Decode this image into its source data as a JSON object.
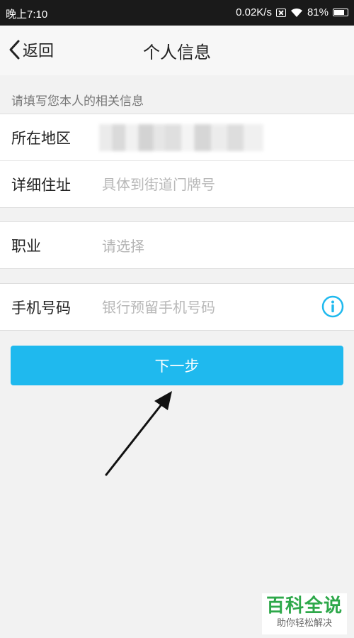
{
  "status_bar": {
    "time": "晚上7:10",
    "speed": "0.02K/s",
    "battery_percent": "81%",
    "battery_level": 0.81
  },
  "nav": {
    "back_label": "返回",
    "title": "个人信息"
  },
  "hint": "请填写您本人的相关信息",
  "form": {
    "region_label": "所在地区",
    "address_label": "详细住址",
    "address_placeholder": "具体到街道门牌号",
    "occupation_label": "职业",
    "occupation_placeholder": "请选择",
    "phone_label": "手机号码",
    "phone_placeholder": "银行预留手机号码"
  },
  "next_button": "下一步",
  "watermark": {
    "main": "百科全说",
    "sub": "助你轻松解决"
  },
  "colors": {
    "accent": "#1fb9ee",
    "info_icon": "#1fb9ee",
    "watermark": "#2ea84a"
  }
}
